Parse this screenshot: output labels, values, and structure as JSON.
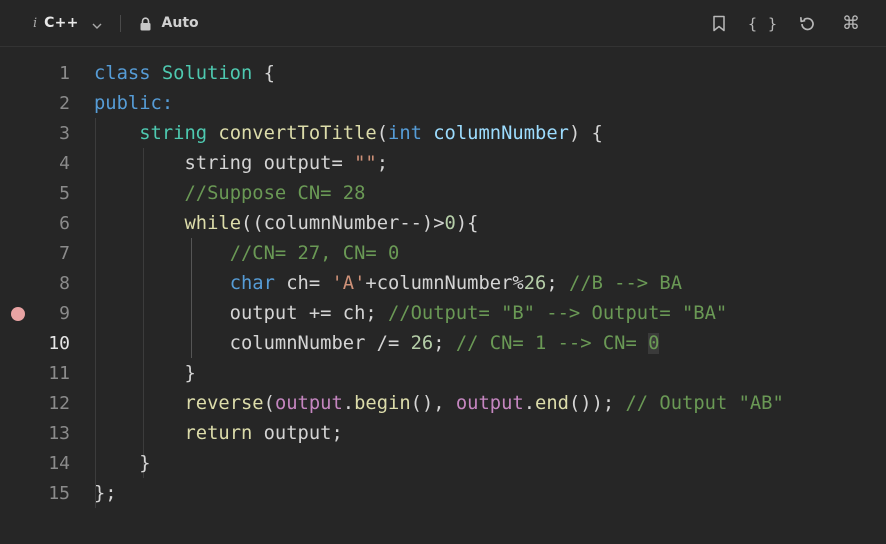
{
  "toolbar": {
    "info_glyph": "i",
    "language": "C++",
    "mode": "Auto",
    "icons": [
      "chevron-down-icon",
      "lock-icon",
      "bookmark-icon",
      "braces-icon",
      "reset-icon",
      "command-icon"
    ],
    "braces_glyph": "{ }",
    "command_glyph": "⌘"
  },
  "editor": {
    "active_line": 10,
    "breakpoint_line": 9,
    "breakpoint_color": "#e8a3a3",
    "line_numbers": [
      "1",
      "2",
      "3",
      "4",
      "5",
      "6",
      "7",
      "8",
      "9",
      "10",
      "11",
      "12",
      "13",
      "14",
      "15"
    ],
    "lines": [
      [
        {
          "t": "class ",
          "c": "kw"
        },
        {
          "t": "Solution",
          "c": "ty"
        },
        {
          "t": " {",
          "c": "pl"
        }
      ],
      [
        {
          "t": "public:",
          "c": "kw"
        }
      ],
      [
        {
          "t": "    ",
          "c": "pl"
        },
        {
          "t": "string",
          "c": "ty"
        },
        {
          "t": " ",
          "c": "pl"
        },
        {
          "t": "convertToTitle",
          "c": "fn"
        },
        {
          "t": "(",
          "c": "pl"
        },
        {
          "t": "int",
          "c": "kw"
        },
        {
          "t": " ",
          "c": "pl"
        },
        {
          "t": "columnNumber",
          "c": "pm"
        },
        {
          "t": ") {",
          "c": "pl"
        }
      ],
      [
        {
          "t": "        string output= ",
          "c": "pl"
        },
        {
          "t": "\"\"",
          "c": "st"
        },
        {
          "t": ";",
          "c": "pl"
        }
      ],
      [
        {
          "t": "        ",
          "c": "pl"
        },
        {
          "t": "//Suppose CN= 28",
          "c": "cm"
        }
      ],
      [
        {
          "t": "        ",
          "c": "pl"
        },
        {
          "t": "while",
          "c": "fn"
        },
        {
          "t": "((columnNumber--)>",
          "c": "pl"
        },
        {
          "t": "0",
          "c": "nm"
        },
        {
          "t": "){",
          "c": "pl"
        }
      ],
      [
        {
          "t": "            ",
          "c": "pl"
        },
        {
          "t": "//CN= 27, CN= 0",
          "c": "cm"
        }
      ],
      [
        {
          "t": "            ",
          "c": "pl"
        },
        {
          "t": "char",
          "c": "kw"
        },
        {
          "t": " ch= ",
          "c": "pl"
        },
        {
          "t": "'A'",
          "c": "st"
        },
        {
          "t": "+columnNumber%",
          "c": "pl"
        },
        {
          "t": "26",
          "c": "nm"
        },
        {
          "t": "; ",
          "c": "pl"
        },
        {
          "t": "//B --> BA",
          "c": "cm"
        }
      ],
      [
        {
          "t": "            output += ch; ",
          "c": "pl"
        },
        {
          "t": "//Output= \"B\" --> Output= \"BA\"",
          "c": "cm"
        }
      ],
      [
        {
          "t": "            columnNumber /= ",
          "c": "pl"
        },
        {
          "t": "26",
          "c": "nm"
        },
        {
          "t": "; ",
          "c": "pl"
        },
        {
          "t": "// CN= 1 --> CN= ",
          "c": "cm"
        },
        {
          "t": "0",
          "c": "cm",
          "box": true
        }
      ],
      [
        {
          "t": "        }",
          "c": "pl"
        }
      ],
      [
        {
          "t": "        ",
          "c": "pl"
        },
        {
          "t": "reverse",
          "c": "fn"
        },
        {
          "t": "(",
          "c": "pl"
        },
        {
          "t": "output",
          "c": "ct"
        },
        {
          "t": ".",
          "c": "pl"
        },
        {
          "t": "begin",
          "c": "fn"
        },
        {
          "t": "(), ",
          "c": "pl"
        },
        {
          "t": "output",
          "c": "ct"
        },
        {
          "t": ".",
          "c": "pl"
        },
        {
          "t": "end",
          "c": "fn"
        },
        {
          "t": "()); ",
          "c": "pl"
        },
        {
          "t": "// Output \"AB\"",
          "c": "cm"
        }
      ],
      [
        {
          "t": "        ",
          "c": "pl"
        },
        {
          "t": "return",
          "c": "fn"
        },
        {
          "t": " output;",
          "c": "pl"
        }
      ],
      [
        {
          "t": "    }",
          "c": "pl"
        }
      ],
      [
        {
          "t": "};",
          "c": "pl"
        }
      ]
    ]
  }
}
